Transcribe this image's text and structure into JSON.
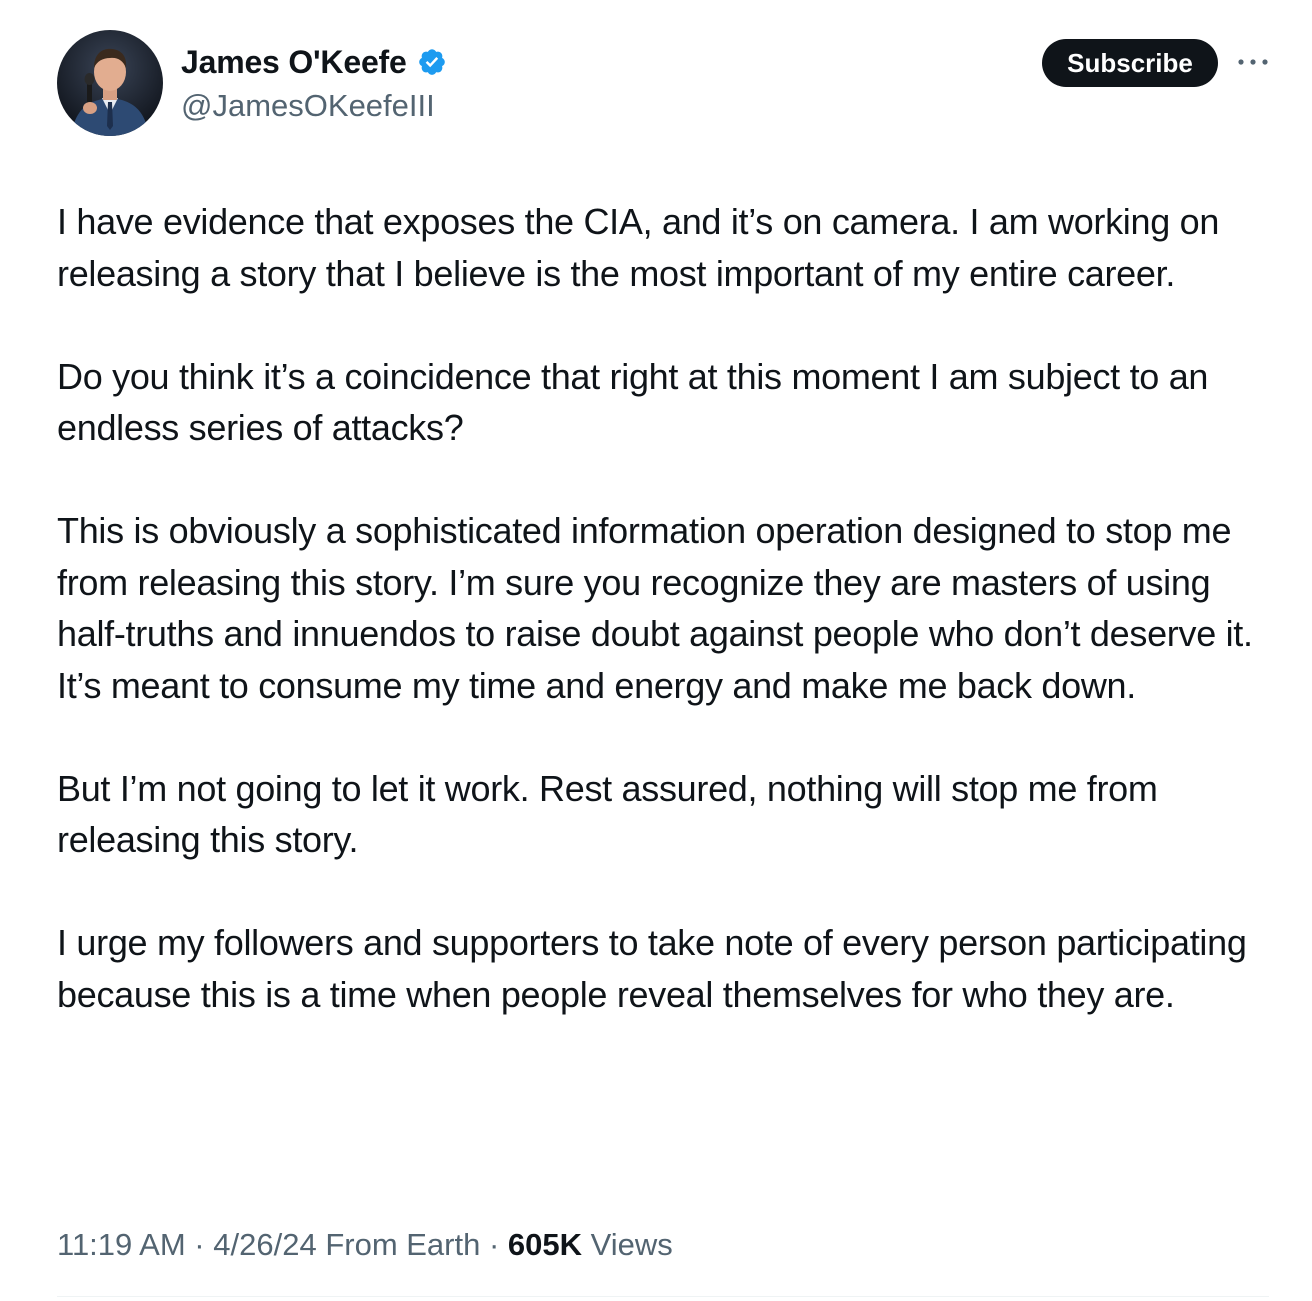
{
  "author": {
    "display_name": "James O'Keefe",
    "handle": "@JamesOKeefeIII",
    "verified": true,
    "verified_color": "#1d9bf0",
    "avatar_icon": "profile-photo"
  },
  "actions": {
    "subscribe_label": "Subscribe",
    "more_icon": "more-horizontal-icon"
  },
  "tweet": {
    "paragraphs": [
      "I have evidence that exposes the CIA, and it’s on camera. I am working on releasing a story that I believe is the most important of my entire career.",
      "Do you think it’s a coincidence that right at this moment I am subject to an endless series of attacks?",
      "This is obviously a sophisticated information operation designed to stop me from releasing this story. I’m sure you recognize they are masters of using half-truths and innuendos to raise doubt against people who don’t deserve it. It’s meant to consume my time and energy and make me back down.",
      "But I’m not going to let it work. Rest assured, nothing will stop me from releasing this story.",
      "I urge my followers and supporters to take note of every person participating because this is a time when people reveal themselves for who they are."
    ]
  },
  "meta": {
    "time": "11:19 AM",
    "separator": " · ",
    "date": "4/26/24",
    "source": "From Earth",
    "views_count": "605K",
    "views_label": "Views"
  },
  "colors": {
    "text_primary": "#0f1419",
    "text_secondary": "#536471",
    "button_bg": "#0f1419",
    "divider": "#eff3f4"
  }
}
